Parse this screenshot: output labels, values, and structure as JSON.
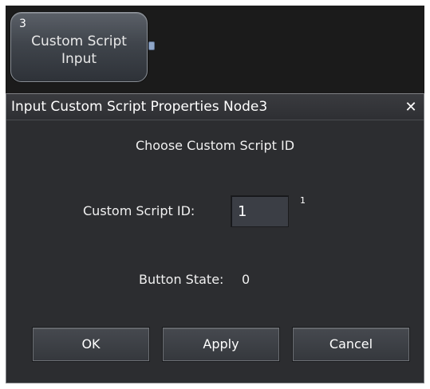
{
  "node": {
    "index": "3",
    "title": "Custom Script\nInput"
  },
  "dialog": {
    "title": "Input Custom Script Properties Node3",
    "close_icon": "close-icon",
    "heading": "Choose Custom Script ID",
    "id_label": "Custom Script ID:",
    "id_value": "1",
    "id_superscript": "1",
    "state_label": "Button State:",
    "state_value": "0",
    "buttons": {
      "ok": "OK",
      "apply": "Apply",
      "cancel": "Cancel"
    }
  },
  "colors": {
    "canvas": "#1b1b1b",
    "dialog_background": "#2c2d30",
    "port": "#8fa6c8"
  }
}
